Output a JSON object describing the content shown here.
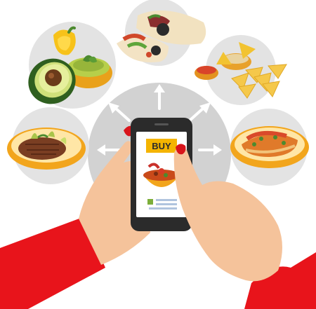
{
  "phone": {
    "buy_label": "BUY"
  },
  "colors": {
    "sleeve": "#e8141b",
    "skin": "#f5c39b",
    "nail": "#d8141b",
    "phone_body": "#2b2b2b",
    "buy_button": "#f4b400",
    "plate_rim": "#f2a51c",
    "hub_circle": "#cfcfcf",
    "backdrop_circle": "#e0e0e0"
  },
  "icons": {
    "dishes": [
      "guacamole-avocado-dish-icon",
      "burrito-wraps-dish-icon",
      "nachos-salsa-dish-icon",
      "steak-plate-dish-icon",
      "enchiladas-plate-dish-icon",
      "soup-bowl-icon"
    ]
  }
}
